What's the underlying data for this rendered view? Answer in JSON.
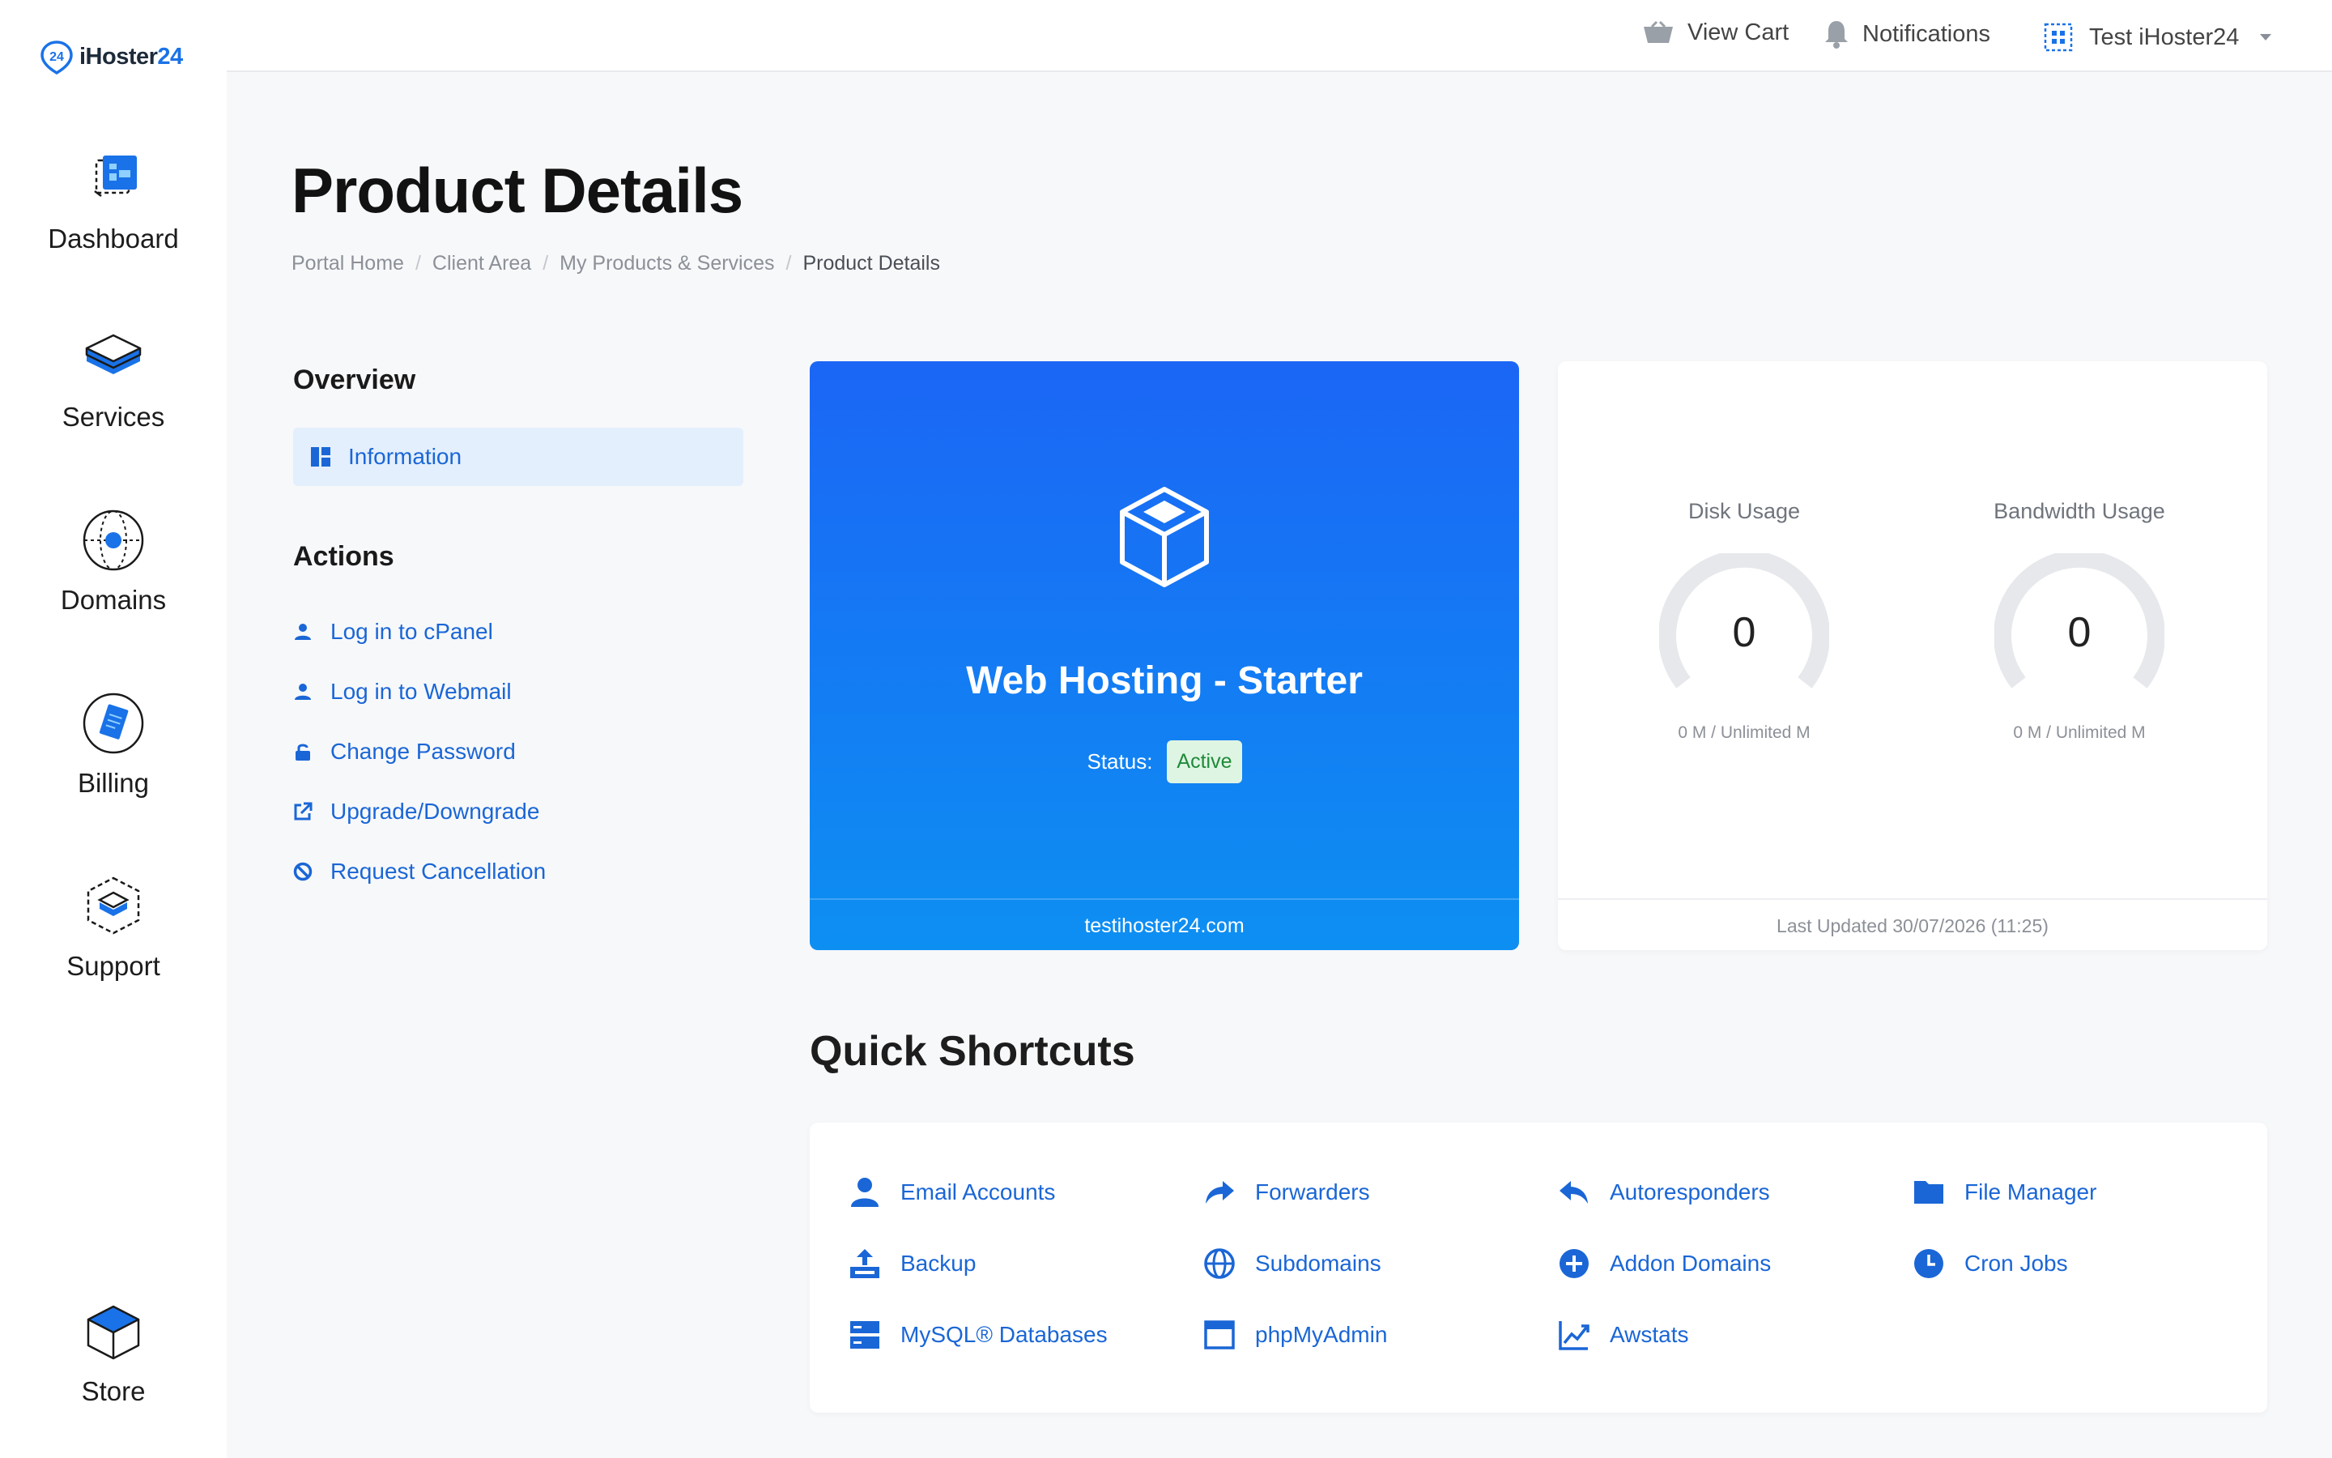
{
  "brand": {
    "logo_mark": "24",
    "name_a": "iHoster",
    "name_b": "24"
  },
  "sidebar": {
    "items": [
      {
        "label": "Dashboard",
        "icon": "dashboard-icon"
      },
      {
        "label": "Services",
        "icon": "services-icon"
      },
      {
        "label": "Domains",
        "icon": "domains-icon"
      },
      {
        "label": "Billing",
        "icon": "billing-icon"
      },
      {
        "label": "Support",
        "icon": "support-icon"
      },
      {
        "label": "Store",
        "icon": "store-icon"
      }
    ]
  },
  "topbar": {
    "view_cart": "View Cart",
    "notifications": "Notifications",
    "user": "Test iHoster24"
  },
  "page": {
    "title": "Product Details",
    "breadcrumb": [
      "Portal Home",
      "Client Area",
      "My Products & Services",
      "Product Details"
    ]
  },
  "overview": {
    "heading": "Overview",
    "item": "Information"
  },
  "actions": {
    "heading": "Actions",
    "items": [
      "Log in to cPanel",
      "Log in to Webmail",
      "Change Password",
      "Upgrade/Downgrade",
      "Request Cancellation"
    ]
  },
  "product": {
    "name": "Web Hosting - Starter",
    "status_label": "Status:",
    "status": "Active",
    "domain": "testihoster24.com"
  },
  "usage": {
    "disk": {
      "title": "Disk Usage",
      "value": "0",
      "detail": "0 M / Unlimited M",
      "fraction": 0
    },
    "bandwidth": {
      "title": "Bandwidth Usage",
      "value": "0",
      "detail": "0 M / Unlimited M",
      "fraction": 0
    },
    "last_updated": "Last Updated 30/07/2026 (11:25)"
  },
  "shortcuts": {
    "title": "Quick Shortcuts",
    "items": [
      "Email Accounts",
      "Forwarders",
      "Autoresponders",
      "File Manager",
      "Backup",
      "Subdomains",
      "Addon Domains",
      "Cron Jobs",
      "MySQL® Databases",
      "phpMyAdmin",
      "Awstats"
    ]
  },
  "colors": {
    "accent": "#1a66d6",
    "card_gradient_top": "#1b66f5",
    "card_gradient_bottom": "#0d8ff2",
    "status_active": "#1f8a3a"
  }
}
